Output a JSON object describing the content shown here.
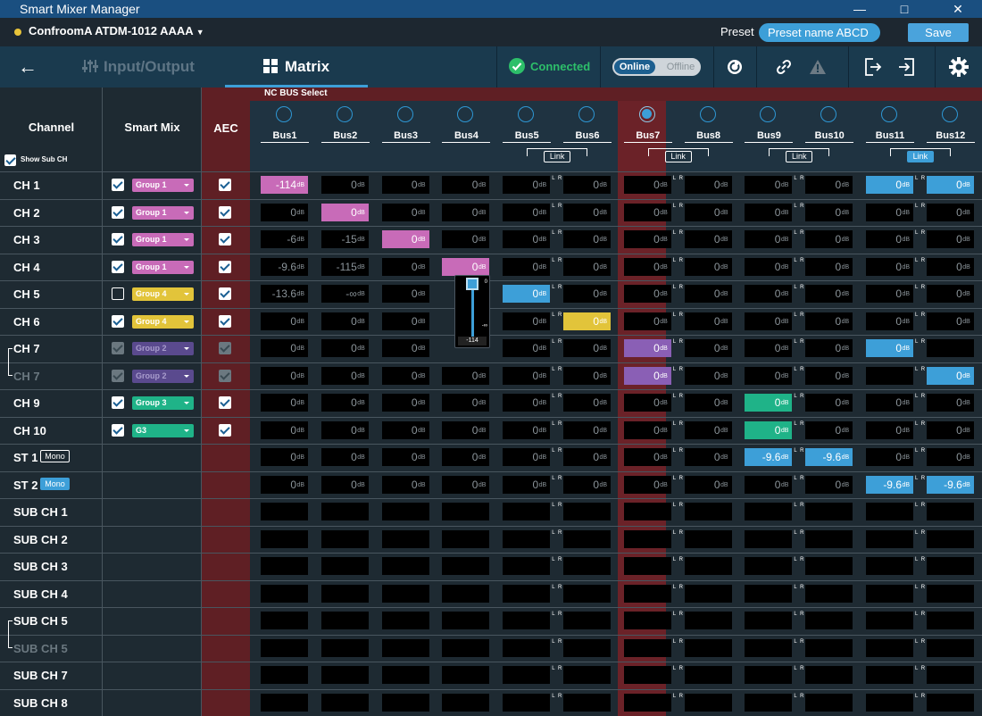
{
  "app": {
    "title": "Smart Mixer Manager"
  },
  "menubar": {
    "device_name": "ConfroomA ATDM-1012 AAAA",
    "preset_label": "Preset",
    "preset_value": "Preset name ABCD",
    "save_label": "Save"
  },
  "nav": {
    "input_output": "Input/Output",
    "matrix": "Matrix",
    "connected": "Connected",
    "online": "Online",
    "offline": "Offline"
  },
  "headers": {
    "channel": "Channel",
    "smart_mix": "Smart Mix",
    "aec": "AEC",
    "nc_bus_select": "NC BUS Select",
    "show_sub_ch": "Show Sub CH",
    "link": "Link"
  },
  "colors": {
    "group1": "#c86bb8",
    "group4": "#e2c43a",
    "group2": "#5a4a8e",
    "group3": "#1fb388",
    "active_blue": "#3d9fd8",
    "selected_bus": "#6b2228"
  },
  "buses": [
    "Bus1",
    "Bus2",
    "Bus3",
    "Bus4",
    "Bus5",
    "Bus6",
    "Bus7",
    "Bus8",
    "Bus9",
    "Bus10",
    "Bus11",
    "Bus12"
  ],
  "selected_bus": 6,
  "rows": [
    {
      "label": "CH 1",
      "smart": "on",
      "group": "Group 1",
      "gcolor": "#c86bb8",
      "aec": "on",
      "cells": [
        "-114",
        "0",
        "0",
        "0",
        "0",
        "0",
        "0",
        "0",
        "0",
        "0",
        "0",
        "0"
      ],
      "active": {
        "0": "#c86bb8",
        "10": "#3d9fd8",
        "11": "#3d9fd8"
      }
    },
    {
      "label": "CH 2",
      "smart": "on",
      "group": "Group 1",
      "gcolor": "#c86bb8",
      "aec": "on",
      "cells": [
        "0",
        "0",
        "0",
        "0",
        "0",
        "0",
        "0",
        "0",
        "0",
        "0",
        "0",
        "0"
      ],
      "active": {
        "1": "#c86bb8"
      }
    },
    {
      "label": "CH 3",
      "smart": "on",
      "group": "Group 1",
      "gcolor": "#c86bb8",
      "aec": "on",
      "cells": [
        "-6",
        "-15",
        "0",
        "0",
        "0",
        "0",
        "0",
        "0",
        "0",
        "0",
        "0",
        "0"
      ],
      "active": {
        "2": "#c86bb8"
      }
    },
    {
      "label": "CH 4",
      "smart": "on",
      "group": "Group 1",
      "gcolor": "#c86bb8",
      "aec": "on",
      "cells": [
        "-9.6",
        "-115",
        "0",
        "0",
        "0",
        "0",
        "0",
        "0",
        "0",
        "0",
        "0",
        "0"
      ],
      "active": {
        "3": "#c86bb8"
      }
    },
    {
      "label": "CH 5",
      "smart": "off",
      "group": "Group 4",
      "gcolor": "#e2c43a",
      "aec": "on",
      "cells": [
        "-13.6",
        "-∞",
        "0",
        "",
        "0",
        "0",
        "0",
        "0",
        "0",
        "0",
        "0",
        "0"
      ],
      "active": {
        "4": "#3d9fd8"
      }
    },
    {
      "label": "CH 6",
      "smart": "on",
      "group": "Group 4",
      "gcolor": "#e2c43a",
      "aec": "on",
      "cells": [
        "0",
        "0",
        "0",
        "",
        "0",
        "0",
        "0",
        "0",
        "0",
        "0",
        "0",
        "0"
      ],
      "active": {
        "5": "#e2c43a"
      }
    },
    {
      "label": "CH 7",
      "smart": "dim",
      "group": "Group 2",
      "gcolor": "#5a4a8e",
      "aec": "dim",
      "cells": [
        "0",
        "0",
        "0",
        "",
        "0",
        "0",
        "0",
        "0",
        "0",
        "0",
        "0",
        ""
      ],
      "active": {
        "6": "#8a5fb5",
        "10": "#3d9fd8"
      }
    },
    {
      "label": "CH 7",
      "smart": "dim",
      "group": "Group 2",
      "gcolor": "#5a4a8e",
      "aec": "dim",
      "dimlabel": true,
      "cells": [
        "0",
        "0",
        "0",
        "0",
        "0",
        "0",
        "0",
        "0",
        "0",
        "0",
        "",
        "0"
      ],
      "active": {
        "6": "#8a5fb5",
        "11": "#3d9fd8"
      }
    },
    {
      "label": "CH 9",
      "smart": "on",
      "group": "Group 3",
      "gcolor": "#1fb388",
      "aec": "on",
      "cells": [
        "0",
        "0",
        "0",
        "0",
        "0",
        "0",
        "0",
        "0",
        "0",
        "0",
        "0",
        "0"
      ],
      "active": {
        "8": "#1fb388"
      }
    },
    {
      "label": "CH 10",
      "smart": "on",
      "group": "G3",
      "gcolor": "#1fb388",
      "aec": "on",
      "cells": [
        "0",
        "0",
        "0",
        "0",
        "0",
        "0",
        "0",
        "0",
        "0",
        "0",
        "0",
        "0"
      ],
      "active": {
        "8": "#1fb388"
      }
    },
    {
      "label": "ST 1",
      "badge": "Mono",
      "badgeon": false,
      "cells": [
        "0",
        "0",
        "0",
        "0",
        "0",
        "0",
        "0",
        "0",
        "-9.6",
        "-9.6",
        "0",
        "0"
      ],
      "active": {
        "8": "#3d9fd8",
        "9": "#3d9fd8"
      }
    },
    {
      "label": "ST 2",
      "badge": "Mono",
      "badgeon": true,
      "cells": [
        "0",
        "0",
        "0",
        "0",
        "0",
        "0",
        "0",
        "0",
        "0",
        "0",
        "-9.6",
        "-9.6"
      ],
      "active": {
        "10": "#3d9fd8",
        "11": "#3d9fd8"
      }
    },
    {
      "label": "SUB CH 1",
      "cells": [
        "",
        "",
        "",
        "",
        "",
        "",
        "",
        "",
        "",
        "",
        "",
        ""
      ],
      "active": {}
    },
    {
      "label": "SUB CH 2",
      "cells": [
        "",
        "",
        "",
        "",
        "",
        "",
        "",
        "",
        "",
        "",
        "",
        ""
      ],
      "active": {}
    },
    {
      "label": "SUB CH 3",
      "cells": [
        "",
        "",
        "",
        "",
        "",
        "",
        "",
        "",
        "",
        "",
        "",
        ""
      ],
      "active": {}
    },
    {
      "label": "SUB CH 4",
      "cells": [
        "",
        "",
        "",
        "",
        "",
        "",
        "",
        "",
        "",
        "",
        "",
        ""
      ],
      "active": {}
    },
    {
      "label": "SUB CH 5",
      "cells": [
        "",
        "",
        "",
        "",
        "",
        "",
        "",
        "",
        "",
        "",
        "",
        ""
      ],
      "active": {}
    },
    {
      "label": "SUB CH 5",
      "dimlabel": true,
      "cells": [
        "",
        "",
        "",
        "",
        "",
        "",
        "",
        "",
        "",
        "",
        "",
        ""
      ],
      "active": {}
    },
    {
      "label": "SUB CH 7",
      "cells": [
        "",
        "",
        "",
        "",
        "",
        "",
        "",
        "",
        "",
        "",
        "",
        ""
      ],
      "active": {}
    },
    {
      "label": "SUB CH 8",
      "cells": [
        "",
        "",
        "",
        "",
        "",
        "",
        "",
        "",
        "",
        "",
        "",
        ""
      ],
      "active": {}
    }
  ],
  "fader": {
    "top": "0",
    "bottom": "-∞",
    "value": "-114"
  },
  "db_unit": "dB"
}
